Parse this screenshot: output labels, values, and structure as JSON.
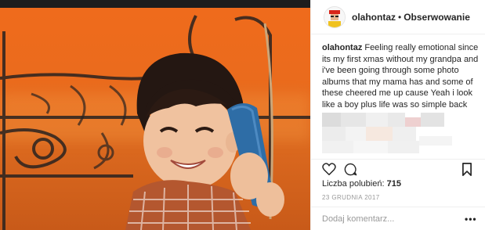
{
  "post": {
    "username": "olahontaz",
    "separator": "•",
    "follow_label": "Obserwowanie",
    "caption_username": "olahontaz",
    "caption_text": "Feeling really emotional since its my first xmas without my grandpa and i've been going through some photo albums that my mama has and some of these cheered me up cause Yeah i look like a boy plus life was so simple back then",
    "likes_label": "Liczba polubień:",
    "likes_count": "715",
    "date": "23 GRUDNIA 2017",
    "comment_placeholder": "Dodaj komentarz...",
    "more_options": "•••"
  },
  "icons": {
    "like": "heart-outline-icon",
    "comment": "speech-bubble-icon",
    "save": "bookmark-icon",
    "more": "ellipsis-icon"
  },
  "colors": {
    "text": "#262626",
    "muted": "#999999",
    "border": "#efefef",
    "photo_background": "#ea6b1d"
  }
}
